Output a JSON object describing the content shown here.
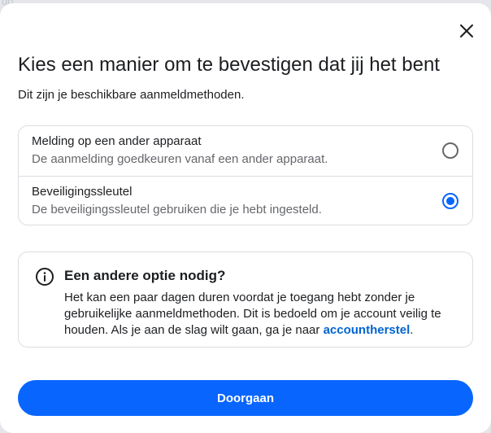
{
  "background": {
    "text": "do"
  },
  "dialog": {
    "title": "Kies een manier om te bevestigen dat jij het bent",
    "subtitle": "Dit zijn je beschikbare aanmeldmethoden.",
    "close_icon": "close-icon"
  },
  "options": [
    {
      "title": "Melding op een ander apparaat",
      "description": "De aanmelding goedkeuren vanaf een ander apparaat.",
      "selected": false
    },
    {
      "title": "Beveiligingssleutel",
      "description": "De beveiligingssleutel gebruiken die je hebt ingesteld.",
      "selected": true
    }
  ],
  "info": {
    "icon": "info-icon",
    "title": "Een andere optie nodig?",
    "text": "Het kan een paar dagen duren voordat je toegang hebt zonder je gebruikelijke aanmeldmethoden. Dit is bedoeld om je account veilig te houden. Als je aan de slag wilt gaan, ga je naar ",
    "link_text": "accountherstel",
    "text_end": "."
  },
  "button": {
    "label": "Doorgaan"
  },
  "colors": {
    "accent": "#0866ff",
    "link": "#0064d1",
    "text_primary": "#1c1e21",
    "text_secondary": "#65676b",
    "border": "#dadde1"
  }
}
